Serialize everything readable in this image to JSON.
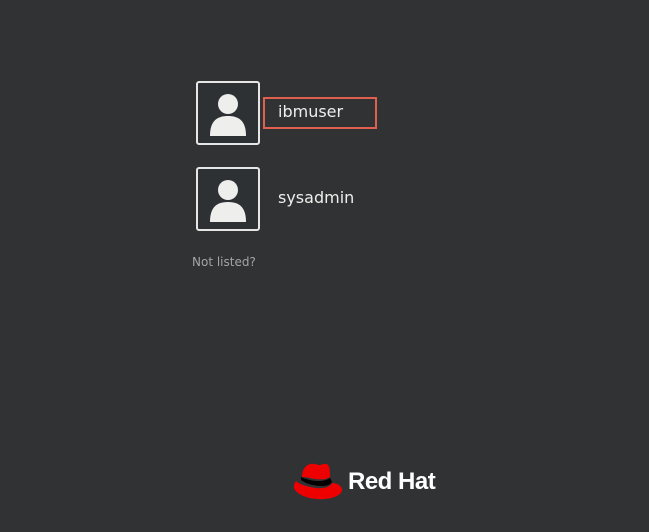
{
  "users": [
    {
      "name": "ibmuser",
      "avatar_icon": "user-silhouette-icon"
    },
    {
      "name": "sysadmin",
      "avatar_icon": "user-silhouette-icon"
    }
  ],
  "not_listed_label": "Not listed?",
  "brand": {
    "logo_icon": "red-hat-fedora-icon",
    "name": "Red Hat",
    "accent_color": "#ee0000"
  },
  "annotation": {
    "highlight_color": "#e0604f"
  },
  "background_color": "#303234"
}
